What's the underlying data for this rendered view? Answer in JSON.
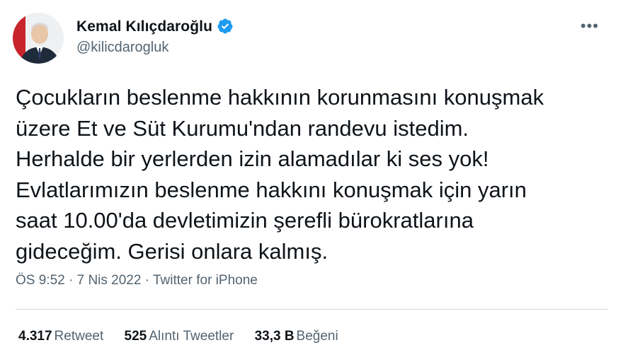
{
  "author": {
    "display_name": "Kemal Kılıçdaroğlu",
    "handle": "@kilicdarogluk",
    "verified_icon": "verified-badge-icon",
    "verified_color": "#1d9bf0"
  },
  "menu": {
    "more_glyph": "•••"
  },
  "tweet": {
    "lines": [
      "Çocukların beslenme hakkının korunmasını konuşmak",
      "üzere Et ve Süt Kurumu'ndan randevu istedim.",
      "Herhalde bir yerlerden izin alamadılar ki ses yok!",
      "Evlatlarımızın beslenme hakkını konuşmak için yarın",
      "saat 10.00'da devletimizin şerefli bürokratlarına",
      "gideceğim. Gerisi onlara kalmış."
    ]
  },
  "meta": {
    "time": "ÖS 9:52",
    "separator": " · ",
    "date": "7 Nis 2022",
    "source": "Twitter for iPhone"
  },
  "stats": {
    "retweets": {
      "value": "4.317",
      "label": "Retweet"
    },
    "quotes": {
      "value": "525",
      "label": "Alıntı Tweetler"
    },
    "likes": {
      "value": "33,3 B",
      "label": "Beğeni"
    }
  }
}
